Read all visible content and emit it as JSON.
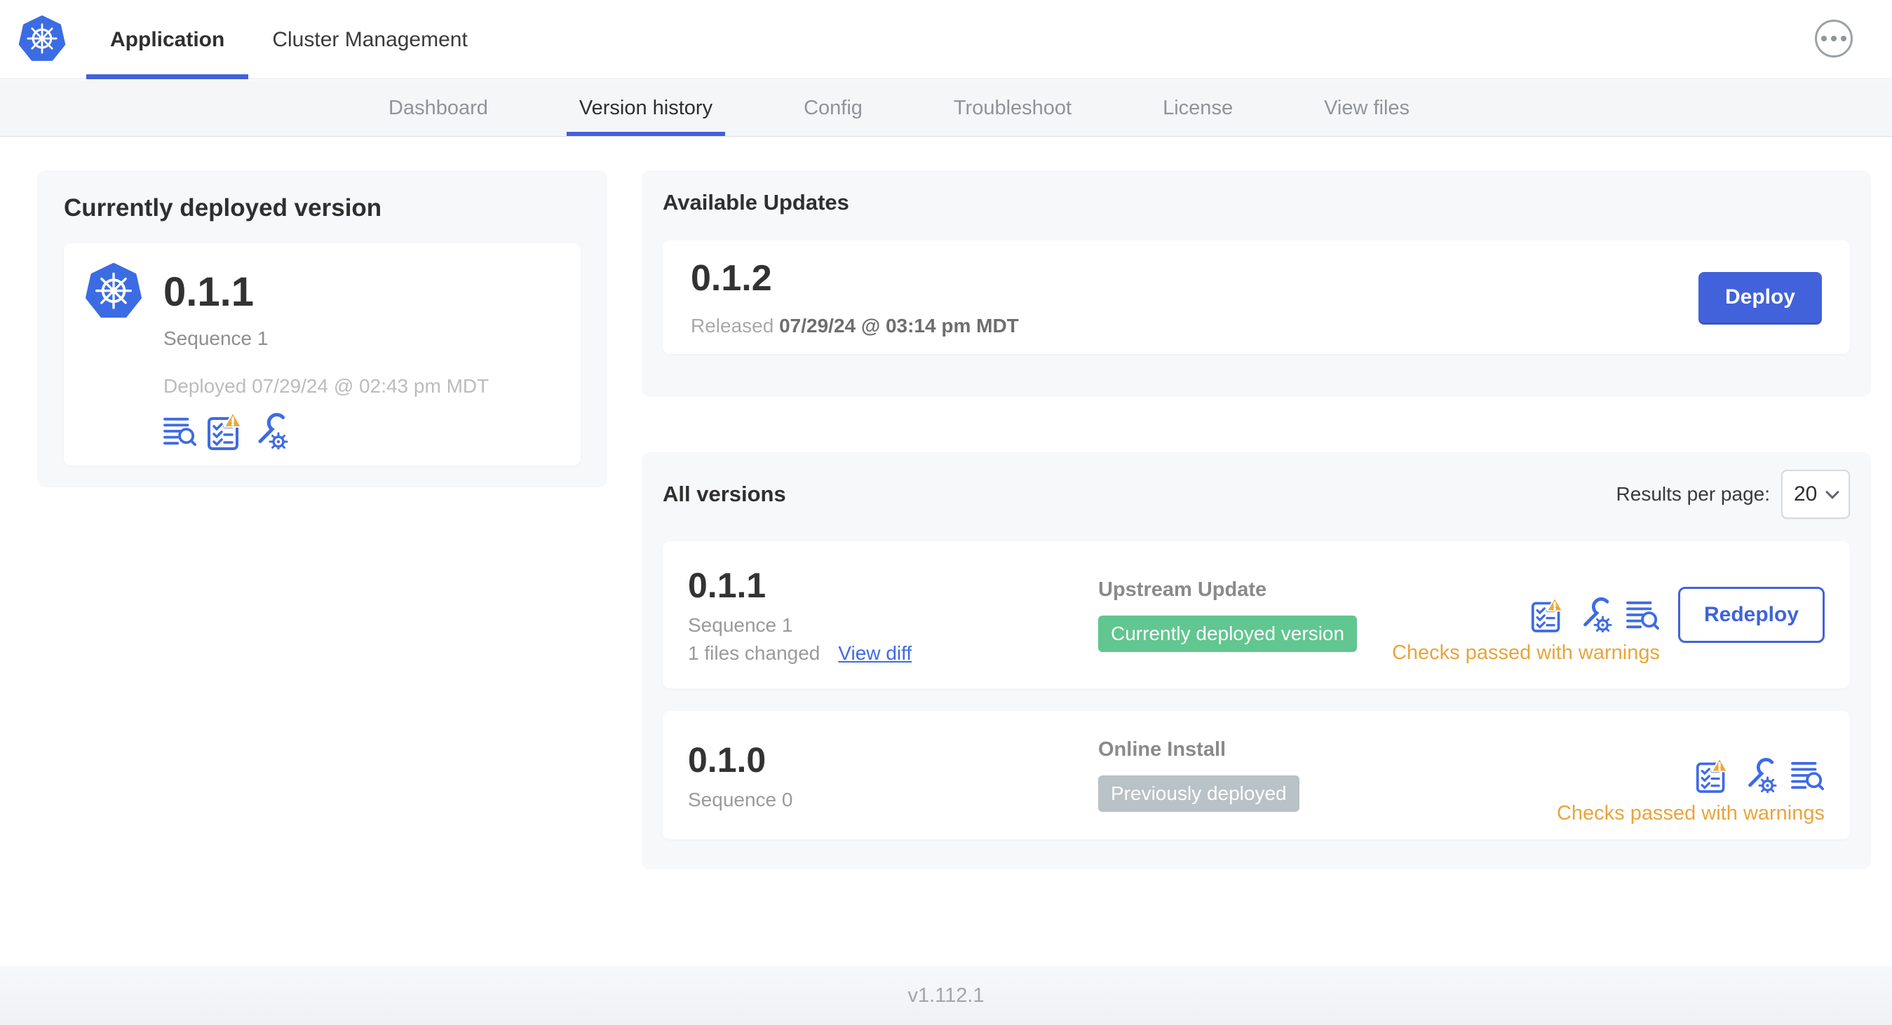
{
  "colors": {
    "primary_blue": "#4262db",
    "link_blue": "#3e6be5",
    "kubernetes_blue": "#3b6ce4",
    "green_badge": "#61c690",
    "gray_badge": "#b9c2c6",
    "warning_orange": "#e9a43c",
    "card_background": "#f7f8fa"
  },
  "icons": {
    "app_logo": "kubernetes-logo",
    "header_more": "ellipsis-icon",
    "select_caret": "chevron-down-icon",
    "version_action_icons": [
      "diff-logs-icon",
      "preflight-checks-warning-icon",
      "edit-config-icon"
    ]
  },
  "header": {
    "tabs": [
      {
        "label": "Application",
        "active": true
      },
      {
        "label": "Cluster Management",
        "active": false
      }
    ]
  },
  "subnav": {
    "items": [
      {
        "label": "Dashboard",
        "active": false
      },
      {
        "label": "Version history",
        "active": true
      },
      {
        "label": "Config",
        "active": false
      },
      {
        "label": "Troubleshoot",
        "active": false
      },
      {
        "label": "License",
        "active": false
      },
      {
        "label": "View files",
        "active": false
      }
    ]
  },
  "deployed_card": {
    "title": "Currently deployed version",
    "version": "0.1.1",
    "sequence": "Sequence 1",
    "deployed_at": "Deployed 07/29/24 @ 02:43 pm MDT"
  },
  "available_updates": {
    "title": "Available Updates",
    "version": "0.1.2",
    "released_prefix": "Released",
    "released_date": "07/29/24 @ 03:14 pm MDT",
    "deploy_label": "Deploy"
  },
  "all_versions": {
    "title": "All versions",
    "results_per_page_label": "Results per page:",
    "results_per_page_value": "20",
    "rows": [
      {
        "version": "0.1.1",
        "sequence": "Sequence 1",
        "files_changed": "1 files changed",
        "view_diff_label": "View diff",
        "source": "Upstream Update",
        "badge": "Currently deployed version",
        "badge_type": "green",
        "checks": "Checks passed with warnings",
        "action_label": "Redeploy"
      },
      {
        "version": "0.1.0",
        "sequence": "Sequence 0",
        "source": "Online Install",
        "badge": "Previously deployed",
        "badge_type": "gray",
        "checks": "Checks passed with warnings"
      }
    ]
  },
  "footer": {
    "app_version": "v1.112.1"
  }
}
